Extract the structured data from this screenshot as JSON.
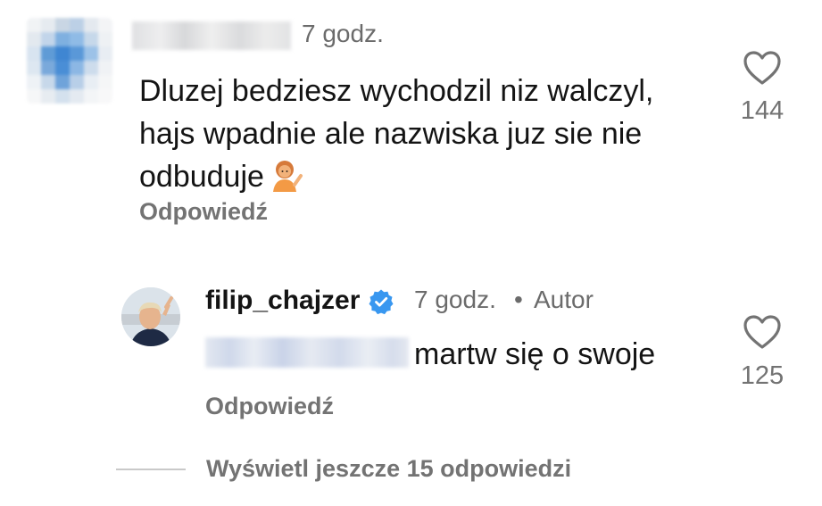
{
  "comment": {
    "time": "7 godz.",
    "text_line1": "Dluzej bedziesz wychodzil niz walczyl,",
    "text_line2": "hajs wpadnie ale nazwiska juz sie nie",
    "text_line3": "odbuduje",
    "emoji_icon": "person-tipping-hand-emoji",
    "reply_label": "Odpowiedź",
    "like_count": "144"
  },
  "reply": {
    "username": "filip_chajzer",
    "verified_icon": "verified-badge-icon",
    "time": "7 godz.",
    "separator": "•",
    "author_label": "Autor",
    "text": "martw się o swoje",
    "reply_label": "Odpowiedź",
    "like_count": "125"
  },
  "view_more_label": "Wyświetl jeszcze 15 odpowiedzi",
  "colors": {
    "muted": "#737373",
    "verified": "#3897f0",
    "text": "#141414"
  }
}
